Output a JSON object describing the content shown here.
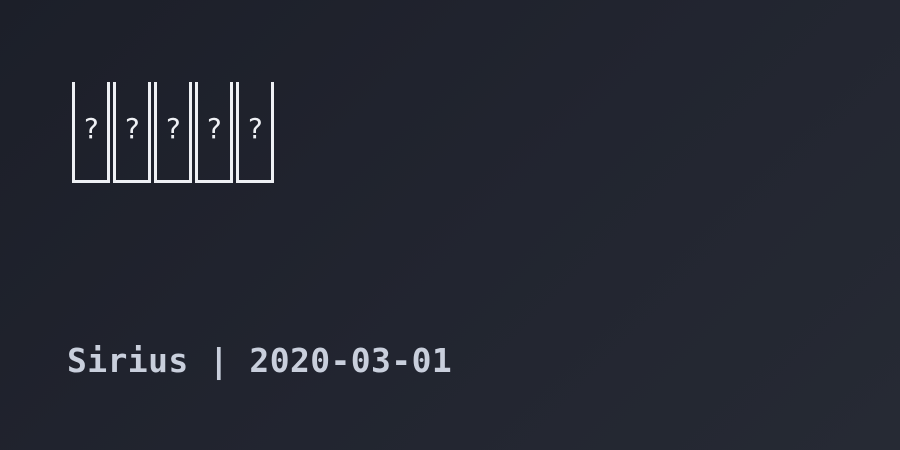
{
  "title": {
    "glyphs": [
      "?",
      "?",
      "?",
      "?",
      "?"
    ]
  },
  "footer": {
    "author": "Sirius",
    "separator": " | ",
    "date": "2020-03-01"
  }
}
